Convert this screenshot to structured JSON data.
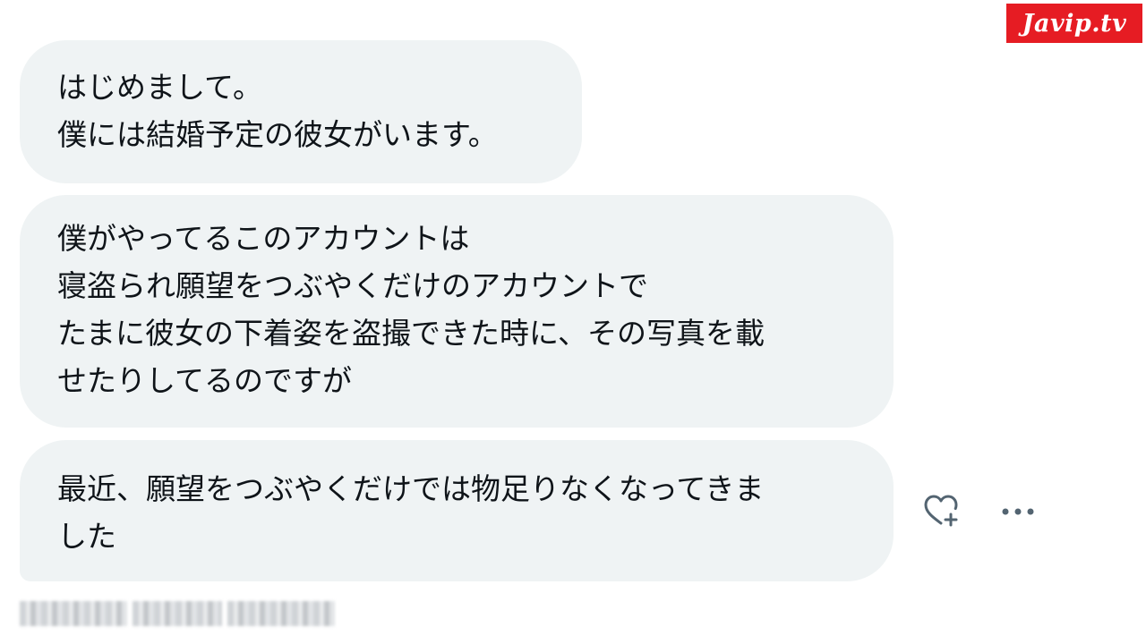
{
  "logo": {
    "text": "Javip.tv",
    "color": "#e61c23"
  },
  "messages": [
    {
      "lines": [
        "はじめまして。",
        "僕には結婚予定の彼女がいます。"
      ]
    },
    {
      "lines": [
        "僕がやってるこのアカウントは",
        "寝盗られ願望をつぶやくだけのアカウントで",
        "たまに彼女の下着姿を盗撮できた時に、その写真を載",
        "せたりしてるのですが"
      ]
    },
    {
      "lines": [
        "最近、願望をつぶやくだけでは物足りなくなってきま",
        "した"
      ]
    }
  ],
  "actions": {
    "react_icon": "heart-plus-icon",
    "more_icon": "more-horizontal-icon"
  },
  "colors": {
    "bubble": "#eff3f4",
    "text": "#0f1419",
    "icon": "#536471"
  }
}
